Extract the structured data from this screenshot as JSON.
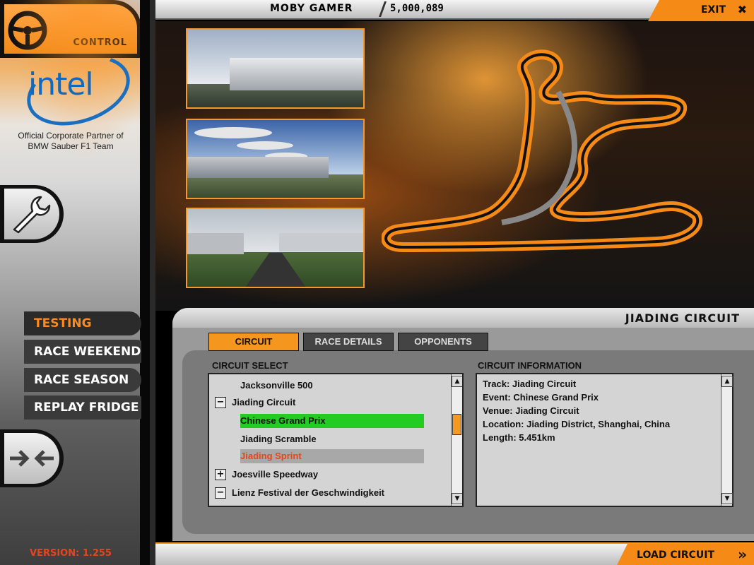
{
  "sidebar": {
    "brand_word": "intel",
    "partner_line1": "Official Corporate Partner of",
    "partner_line2": "BMW Sauber F1 Team",
    "control_label": "CONTROL",
    "menu": [
      {
        "label": "TESTING",
        "active": true
      },
      {
        "label": "RACE WEEKEND",
        "active": false
      },
      {
        "label": "RACE SEASON",
        "active": false
      },
      {
        "label": "REPLAY FRIDGE",
        "active": false
      }
    ],
    "version": "VERSION: 1.255"
  },
  "topbar": {
    "gamer_name": "MOBY GAMER",
    "gamer_score": "5,000,089",
    "exit_label": "EXIT"
  },
  "panel": {
    "title": "JIADING CIRCUIT",
    "tabs": [
      {
        "label": "CIRCUIT",
        "active": true
      },
      {
        "label": "RACE DETAILS",
        "active": false
      },
      {
        "label": "OPPONENTS",
        "active": false
      }
    ],
    "select_label": "CIRCUIT SELECT",
    "info_label": "CIRCUIT INFORMATION",
    "list": [
      {
        "text": "Jacksonville 500",
        "level": 1,
        "expander": ""
      },
      {
        "text": "Jiading Circuit",
        "level": 0,
        "expander": "−"
      },
      {
        "text": "Chinese Grand Prix",
        "level": 1,
        "expander": "",
        "highlight": "green"
      },
      {
        "text": "Jiading Scramble",
        "level": 1,
        "expander": ""
      },
      {
        "text": "Jiading Sprint",
        "level": 1,
        "expander": "",
        "highlight": "grey"
      },
      {
        "text": "Joesville Speedway",
        "level": 0,
        "expander": "+"
      },
      {
        "text": "Lienz Festival der Geschwindigkeit",
        "level": 0,
        "expander": "−"
      }
    ],
    "info": [
      "Track: Jiading Circuit",
      "Event: Chinese Grand Prix",
      "Venue: Jiading Circuit",
      "Location: Jiading District, Shanghai, China",
      "Length: 5.451km"
    ]
  },
  "bottombar": {
    "load_label": "LOAD CIRCUIT"
  },
  "colors": {
    "accent": "#f58a16",
    "highlight_green": "#22cc22",
    "warning_red": "#e8451c"
  }
}
